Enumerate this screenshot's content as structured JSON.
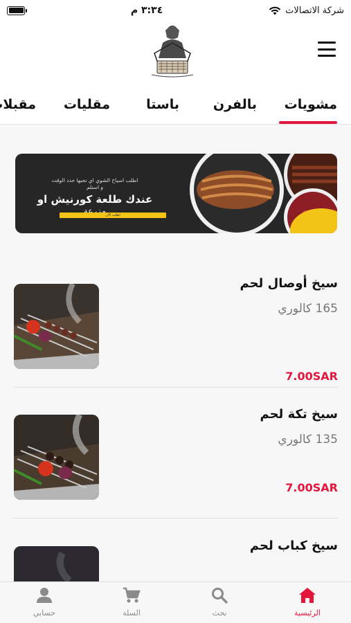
{
  "status_bar": {
    "carrier": "شركة الاتصالات",
    "time": "٣:٣٤ م"
  },
  "header": {
    "logo_icon": "restaurant-logo-icon",
    "menu_icon": "hamburger-menu-icon"
  },
  "tabs": {
    "items": [
      "مشويات",
      "بالفرن",
      "باستا",
      "مقليات",
      "مقبلات"
    ],
    "active": "مشويات",
    "accent_color": "#e3173e"
  },
  "banner": {
    "line1": "اطلب اسياخ الشوي اي تحبها حدد الوقت",
    "line2": "و استلم",
    "line3": "عندك طلعة كورنيش او",
    "line4": "مزرعة",
    "button": "اطلب الآن"
  },
  "items": [
    {
      "name": "سيخ أوصال لحم",
      "calories": "165 كالوري",
      "price": "7.00SAR"
    },
    {
      "name": "سيخ تكة لحم",
      "calories": "135 كالوري",
      "price": "7.00SAR"
    },
    {
      "name": "سيخ كباب لحم",
      "calories": "",
      "price": ""
    }
  ],
  "bottom_nav": {
    "items": [
      {
        "label": "الرئيسية",
        "icon": "home-icon"
      },
      {
        "label": "بحث",
        "icon": "search-icon"
      },
      {
        "label": "السلة",
        "icon": "cart-icon"
      },
      {
        "label": "حسابي",
        "icon": "user-icon"
      }
    ],
    "active": "الرئيسية",
    "active_color": "#e3173e",
    "inactive_color": "#8a8a8a"
  }
}
